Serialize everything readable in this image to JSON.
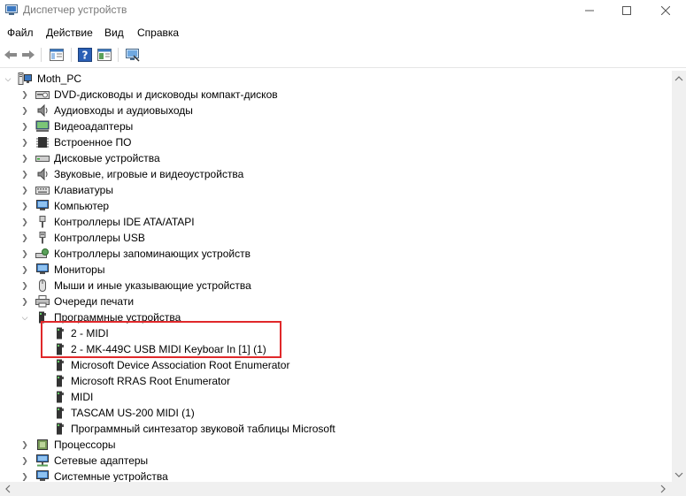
{
  "window": {
    "title": "Диспетчер устройств"
  },
  "menu": [
    "Файл",
    "Действие",
    "Вид",
    "Справка"
  ],
  "tree": {
    "root": "Moth_PC",
    "categories": [
      {
        "label": "DVD-дисководы и дисководы компакт-дисков",
        "icon": "dvd-drive-icon"
      },
      {
        "label": "Аудиовходы и аудиовыходы",
        "icon": "speaker-icon"
      },
      {
        "label": "Видеоадаптеры",
        "icon": "display-adapter-icon"
      },
      {
        "label": "Встроенное ПО",
        "icon": "firmware-icon"
      },
      {
        "label": "Дисковые устройства",
        "icon": "disk-drive-icon"
      },
      {
        "label": "Звуковые, игровые и видеоустройства",
        "icon": "speaker-icon"
      },
      {
        "label": "Клавиатуры",
        "icon": "keyboard-icon"
      },
      {
        "label": "Компьютер",
        "icon": "computer-icon"
      },
      {
        "label": "Контроллеры IDE ATA/ATAPI",
        "icon": "ide-controller-icon"
      },
      {
        "label": "Контроллеры USB",
        "icon": "usb-icon"
      },
      {
        "label": "Контроллеры запоминающих устройств",
        "icon": "storage-controller-icon"
      },
      {
        "label": "Мониторы",
        "icon": "monitor-icon"
      },
      {
        "label": "Мыши и иные указывающие устройства",
        "icon": "mouse-icon"
      },
      {
        "label": "Очереди печати",
        "icon": "printer-icon"
      },
      {
        "label": "Программные устройства",
        "icon": "software-device-icon"
      }
    ],
    "software_devices": [
      "2 - MIDI",
      "2 - MK-449C USB MIDI Keyboar In [1] (1)",
      "Microsoft Device Association Root Enumerator",
      "Microsoft RRAS Root Enumerator",
      "MIDI",
      "TASCAM US-200 MIDI (1)",
      "Программный синтезатор звуковой таблицы Microsoft"
    ],
    "after": [
      {
        "label": "Процессоры",
        "icon": "processor-icon"
      },
      {
        "label": "Сетевые адаптеры",
        "icon": "network-adapter-icon"
      },
      {
        "label": "Системные устройства",
        "icon": "system-device-icon"
      }
    ]
  },
  "colors": {
    "highlight": "#e0282a",
    "icon_blue": "#2a6fc9"
  }
}
